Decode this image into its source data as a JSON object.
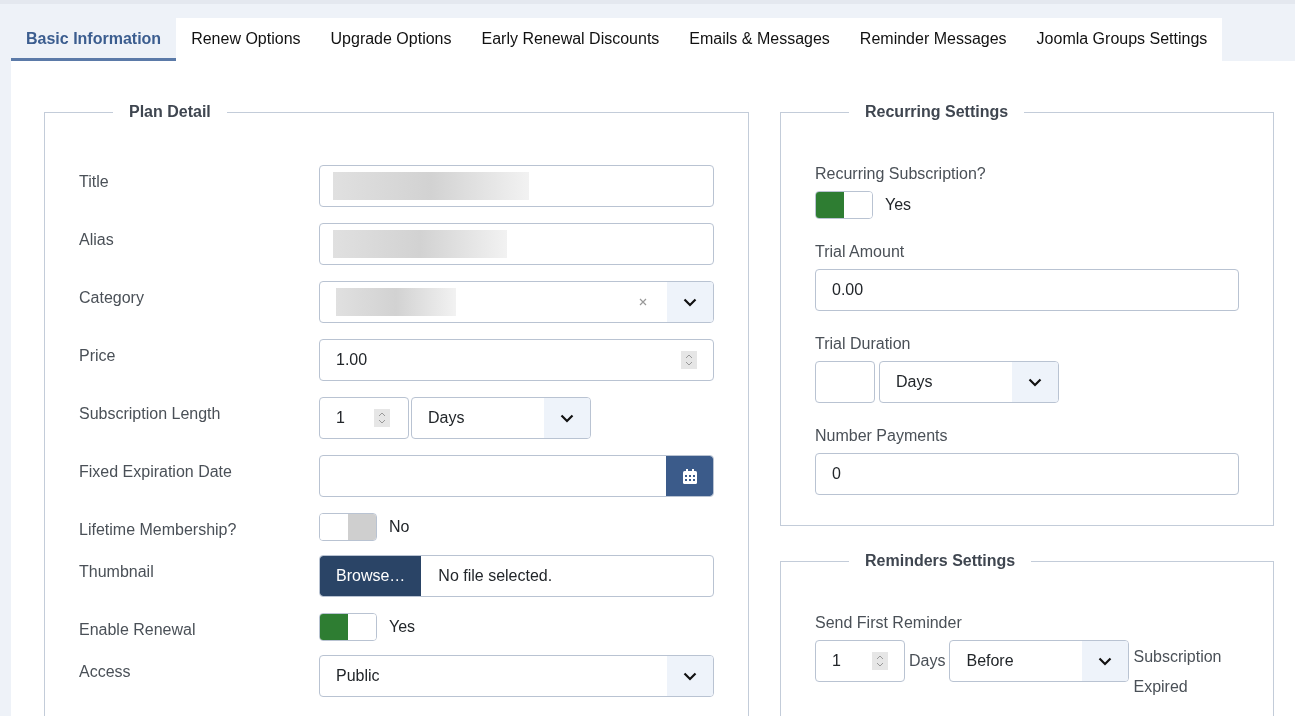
{
  "tabs": [
    {
      "label": "Basic Information",
      "selected": true
    },
    {
      "label": "Renew Options",
      "selected": false
    },
    {
      "label": "Upgrade Options",
      "selected": false
    },
    {
      "label": "Early Renewal Discounts",
      "selected": false
    },
    {
      "label": "Emails & Messages",
      "selected": false
    },
    {
      "label": "Reminder Messages",
      "selected": false
    },
    {
      "label": "Joomla Groups Settings",
      "selected": false
    }
  ],
  "plan_detail": {
    "legend": "Plan Detail",
    "fields": [
      {
        "kind": "redacted",
        "label": "Title"
      },
      {
        "kind": "redacted",
        "label": "Alias"
      },
      {
        "kind": "redacted-select",
        "label": "Category"
      },
      {
        "kind": "number",
        "label": "Price",
        "value": "1.00"
      },
      {
        "kind": "length",
        "label": "Subscription Length",
        "value": "1",
        "unit": "Days"
      },
      {
        "kind": "date",
        "label": "Fixed Expiration Date"
      },
      {
        "kind": "toggle",
        "label": "Lifetime Membership?",
        "on": false,
        "state_label": "No"
      },
      {
        "kind": "file",
        "label": "Thumbnail",
        "button": "Browse…",
        "status": "No file selected."
      },
      {
        "kind": "toggle",
        "label": "Enable Renewal",
        "on": true,
        "state_label": "Yes"
      },
      {
        "kind": "select",
        "label": "Access",
        "value": "Public"
      }
    ]
  },
  "recurring_settings": {
    "legend": "Recurring Settings",
    "fields": [
      {
        "kind": "toggle",
        "label": "Recurring Subscription?",
        "on": true,
        "state_label": "Yes"
      },
      {
        "kind": "text",
        "label": "Trial Amount",
        "value": "0.00"
      },
      {
        "kind": "duration",
        "label": "Trial Duration",
        "unit": "Days"
      },
      {
        "kind": "text",
        "label": "Number Payments",
        "value": "0"
      }
    ]
  },
  "reminders_settings": {
    "legend": "Reminders Settings",
    "fields": [
      {
        "kind": "reminder",
        "label": "Send First Reminder",
        "value": "1",
        "unit_label": "Days",
        "when": "Before",
        "trailing": "Subscription Expired"
      }
    ]
  }
}
